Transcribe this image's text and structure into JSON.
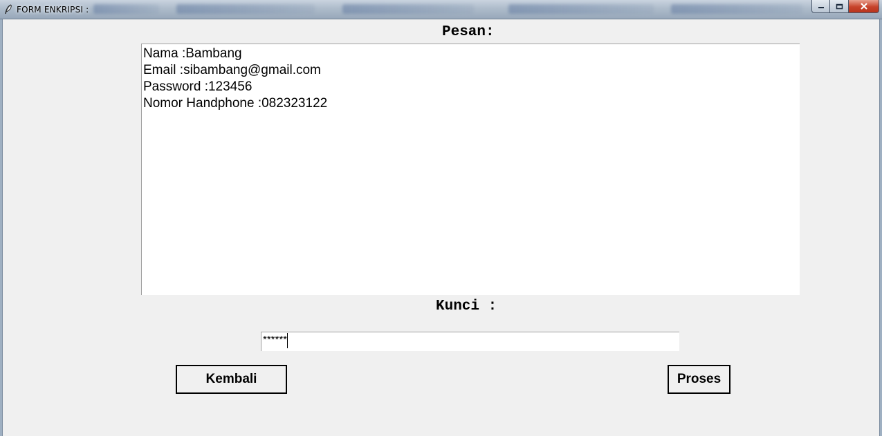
{
  "window": {
    "title": "FORM ENKRIPSI :",
    "app_icon": "feather-icon",
    "controls": [
      "minimize-icon",
      "maximize-icon",
      "close-icon"
    ]
  },
  "form": {
    "message_label": "Pesan:",
    "message_lines": [
      "Nama :Bambang",
      "Email :sibambang@gmail.com",
      "Password :123456",
      "Nomor Handphone :082323122"
    ],
    "key_label": "Kunci :",
    "key_value": "******"
  },
  "buttons": {
    "back_label": "Kembali",
    "process_label": "Proses"
  }
}
